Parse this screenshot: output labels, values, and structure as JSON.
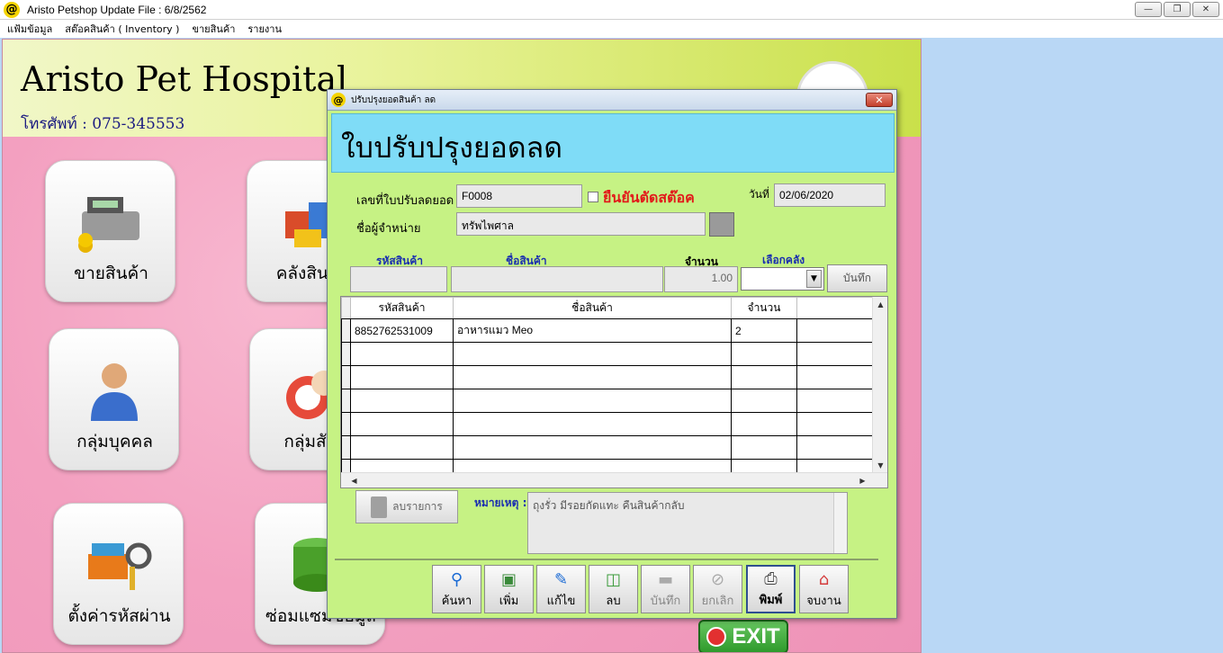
{
  "app": {
    "title": "Aristo Petshop  Update File : 6/8/2562",
    "menu": [
      "แฟ้มข้อมูล",
      "สต๊อคสินค้า ( Inventory )",
      "ขายสินค้า",
      "รายงาน"
    ]
  },
  "main": {
    "hospital_name": "Aristo Pet Hospital",
    "phone": "โทรศัพท์ : 075-345553",
    "tiles": [
      "ขายสินค้า",
      "คลังสินค้า",
      "กลุ่มบุคคล",
      "กลุ่มสัตว์",
      "ตั้งค่ารหัสผ่าน",
      "ซ่อมแซมข้อมูล"
    ],
    "exit_label": "EXIT"
  },
  "dialog": {
    "title": "ปรับปรุงยอดสินค้า ลด",
    "header": "ใบปรับปรุงยอดลด",
    "doc_no_label": "เลขที่ใบปรับลดยอด",
    "doc_no": "F0008",
    "confirm_label": "ยืนยันตัดสต๊อค",
    "date_label": "วันที่",
    "date": "02/06/2020",
    "supplier_label": "ชื่อผู้จำหน่าย",
    "supplier": "ทรัพไพศาล",
    "entry": {
      "code_label": "รหัสสินค้า",
      "name_label": "ชื่อสินค้า",
      "qty_label": "จำนวน",
      "warehouse_label": "เลือกคลัง",
      "code": "",
      "name": "",
      "qty": "1.00",
      "save_label": "บันทึก"
    },
    "grid": {
      "headers": [
        "รหัสสินค้า",
        "ชื่อสินค้า",
        "จำนวน"
      ],
      "rows": [
        [
          "8852762531009",
          "อาหารแมว Meo",
          "2"
        ],
        [
          "",
          "",
          ""
        ],
        [
          "",
          "",
          ""
        ],
        [
          "",
          "",
          ""
        ],
        [
          "",
          "",
          ""
        ],
        [
          "",
          "",
          ""
        ],
        [
          "",
          "",
          ""
        ]
      ]
    },
    "delete_item_label": "ลบรายการ",
    "remark_label": "หมายเหตุ :",
    "remark": "ถุงรั่ว มีรอยกัดแทะ คืนสินค้ากลับ",
    "toolbar": {
      "search": "ค้นหา",
      "add": "เพิ่ม",
      "edit": "แก้ไข",
      "delete": "ลบ",
      "save": "บันทึก",
      "cancel": "ยกเลิก",
      "print": "พิมพ์",
      "close": "จบงาน"
    }
  }
}
